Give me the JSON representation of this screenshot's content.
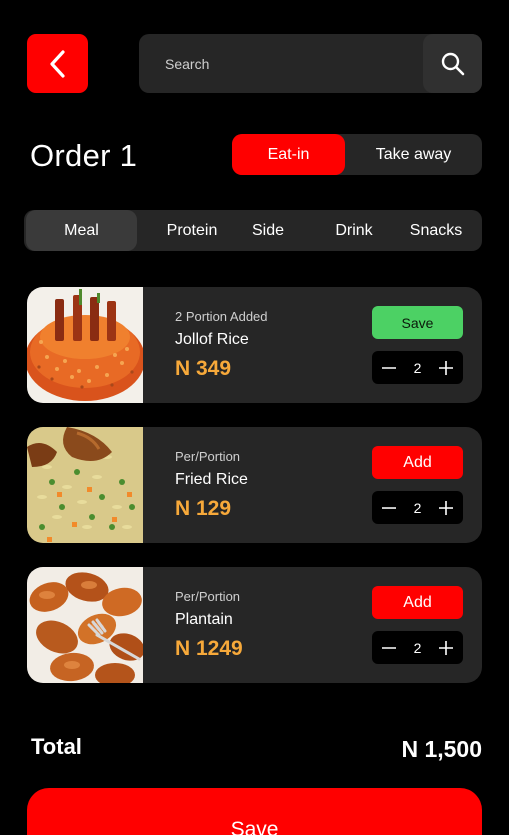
{
  "search": {
    "placeholder": "Search"
  },
  "order": {
    "title": "Order 1"
  },
  "dine_options": [
    {
      "label": "Eat-in",
      "active": true
    },
    {
      "label": "Take away",
      "active": false
    }
  ],
  "categories": [
    {
      "label": "Meal",
      "active": true
    },
    {
      "label": "Protein",
      "active": false
    },
    {
      "label": "Side",
      "active": false
    },
    {
      "label": "Drink",
      "active": false
    },
    {
      "label": "Snacks",
      "active": false
    }
  ],
  "items": [
    {
      "portion": "2 Portion Added",
      "name": "Jollof Rice",
      "price": "N 349",
      "action": "Save",
      "quantity": "2"
    },
    {
      "portion": "Per/Portion",
      "name": "Fried Rice",
      "price": "N 129",
      "action": "Add",
      "quantity": "2"
    },
    {
      "portion": "Per/Portion",
      "name": "Plantain",
      "price": "N 1249",
      "action": "Add",
      "quantity": "2"
    }
  ],
  "total": {
    "label": "Total",
    "value": "N 1,500"
  },
  "footer": {
    "save_label": "Save"
  },
  "colors": {
    "accent": "#ff0000",
    "save_green": "#4cd164",
    "price": "#f7a93a",
    "card": "#262626"
  }
}
